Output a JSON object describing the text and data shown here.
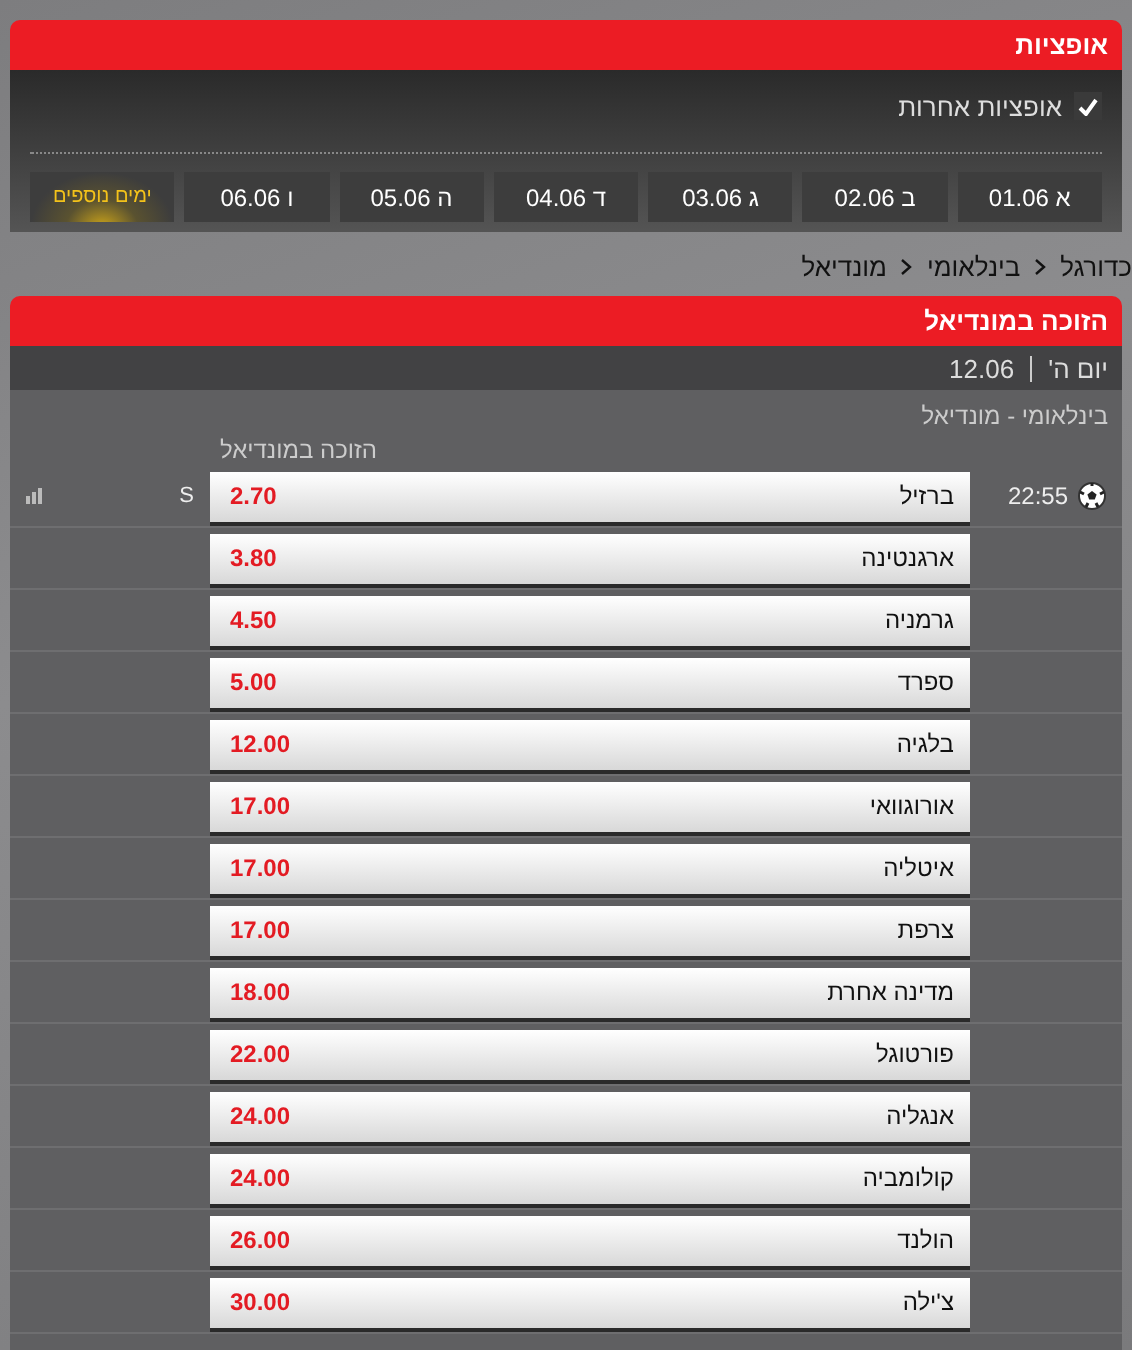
{
  "options_panel": {
    "title": "אופציות",
    "other_options": {
      "label": "אופציות אחרות",
      "checked": true
    },
    "days": [
      {
        "kind": "day",
        "label": "א 01.06"
      },
      {
        "kind": "day",
        "label": "ב 02.06"
      },
      {
        "kind": "day",
        "label": "ג 03.06"
      },
      {
        "kind": "day",
        "label": "ד 04.06"
      },
      {
        "kind": "day",
        "label": "ה 05.06"
      },
      {
        "kind": "day",
        "label": "ו 06.06"
      },
      {
        "kind": "more",
        "label": "ימים נוספים"
      }
    ]
  },
  "breadcrumb": [
    "כדורגל",
    "בינלאומי",
    "מונדיאל"
  ],
  "market_panel": {
    "title": "הזוכה במונדיאל",
    "day": "יום ה'",
    "date": "12.06",
    "competition": "בינלאומי - מונדיאל",
    "market": "הזוכה במונדיאל",
    "time": "22:55",
    "tag": "S",
    "outcomes": [
      {
        "team": "ברזיל",
        "odds": "2.70"
      },
      {
        "team": "ארגנטינה",
        "odds": "3.80"
      },
      {
        "team": "גרמניה",
        "odds": "4.50"
      },
      {
        "team": "ספרד",
        "odds": "5.00"
      },
      {
        "team": "בלגיה",
        "odds": "12.00"
      },
      {
        "team": "אורוגוואי",
        "odds": "17.00"
      },
      {
        "team": "איטליה",
        "odds": "17.00"
      },
      {
        "team": "צרפת",
        "odds": "17.00"
      },
      {
        "team": "מדינה אחרת",
        "odds": "18.00"
      },
      {
        "team": "פורטוגל",
        "odds": "22.00"
      },
      {
        "team": "אנגליה",
        "odds": "24.00"
      },
      {
        "team": "קולומביה",
        "odds": "24.00"
      },
      {
        "team": "הולנד",
        "odds": "26.00"
      },
      {
        "team": "צ'ילה",
        "odds": "30.00"
      }
    ]
  }
}
